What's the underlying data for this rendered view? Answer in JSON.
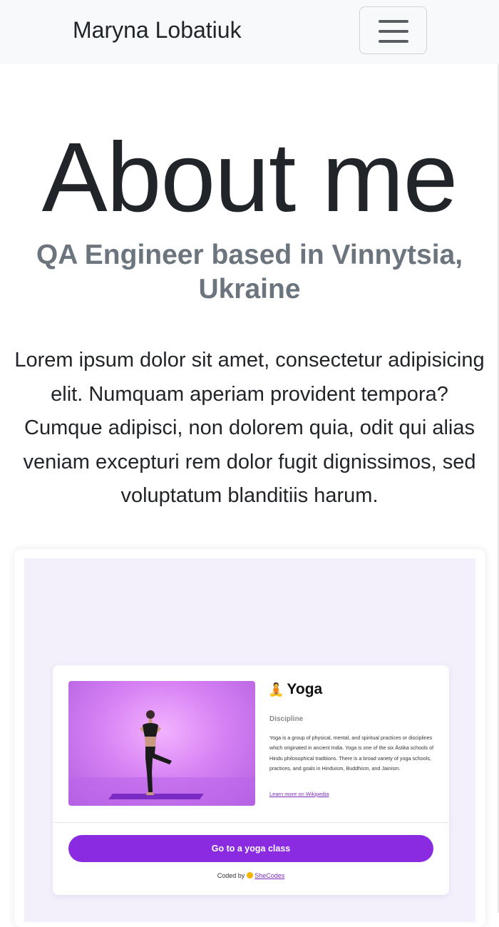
{
  "navbar": {
    "brand": "Maryna Lobatiuk",
    "toggler_icon": "hamburger-menu-icon"
  },
  "hero": {
    "title": "About me",
    "subtitle": "QA Engineer based in Vinnytsia, Ukraine",
    "lead": "Lorem ipsum dolor sit amet, consectetur adipisicing elit. Numquam aperiam provident tempora? Cumque adipisci, non dolorem quia, odit qui alias veniam excepturi rem dolor fugit dignissimos, sed voluptatum blanditiis harum."
  },
  "project": {
    "title": "Yoga",
    "title_icon": "meditating-person-icon",
    "category": "Discipline",
    "description": "Yoga is a group of physical, mental, and spiritual practices or disciplines which originated in ancient India. Yoga is one of the six Āstika schools of Hindu philosophical traditions. There is a broad variety of yoga schools, practices, and goals in Hinduism, Buddhism, and Jainism.",
    "link": "Learn more on Wikipedia",
    "button": "Go to a yoga class",
    "coded_by": "Coded by",
    "coded_by_link": "SheCodes"
  },
  "colors": {
    "navbar_bg": "#f8f9fa",
    "preview_bg": "#f3f0fb",
    "accent_purple": "#8a2be2",
    "muted_text": "#6c757d"
  }
}
